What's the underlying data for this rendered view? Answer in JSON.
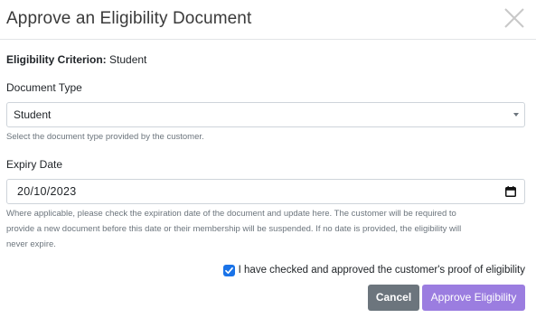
{
  "dialog": {
    "title": "Approve an Eligibility Document"
  },
  "criterion": {
    "label": "Eligibility Criterion:",
    "value": "Student"
  },
  "document_type": {
    "label": "Document Type",
    "selected": "Student",
    "help": "Select the document type provided by the customer."
  },
  "expiry_date": {
    "label": "Expiry Date",
    "value": "20/10/2023",
    "help_line1": "Where applicable, please check the expiration date of the document and update here. The customer will be required to",
    "help_line2": "provide a new document before this date or their membership will be suspended. If no date is provided, the eligibility will",
    "help_line3": "never expire."
  },
  "confirmation": {
    "checked": true,
    "label": "I have checked and approved the customer's proof of eligibility"
  },
  "actions": {
    "cancel_label": "Cancel",
    "approve_label": "Approve Eligibility"
  },
  "colors": {
    "cancel": "#6c757d",
    "approve": "#9b7de0",
    "checkbox": "#1a73e8"
  },
  "icons": {
    "close": "close-icon",
    "caret": "chevron-down-icon",
    "calendar": "calendar-icon",
    "check": "checkmark-icon"
  }
}
